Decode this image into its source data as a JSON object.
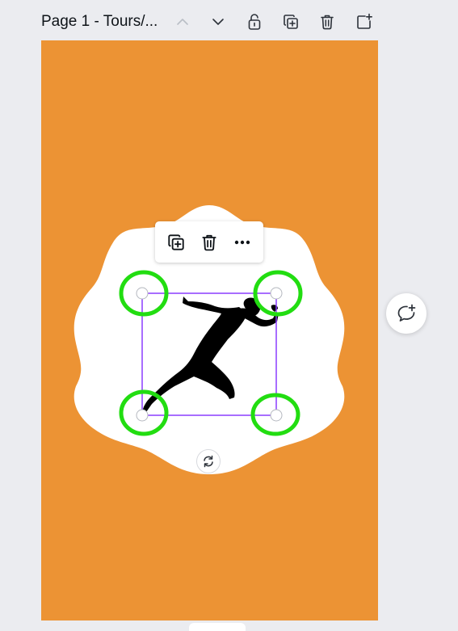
{
  "header": {
    "page_title": "Page 1 - Tours/...",
    "buttons": [
      {
        "name": "chevron-up-icon",
        "label": "Move page up"
      },
      {
        "name": "chevron-down-icon",
        "label": "Move page down"
      },
      {
        "name": "lock-icon",
        "label": "Lock page"
      },
      {
        "name": "duplicate-page-icon",
        "label": "Duplicate page"
      },
      {
        "name": "trash-icon",
        "label": "Delete page"
      },
      {
        "name": "add-page-icon",
        "label": "Add page"
      }
    ]
  },
  "canvas": {
    "background_color": "#ec9334",
    "badge_color": "#ffffff",
    "selection_color": "#8b3dff",
    "highlight_color": "#22dd11",
    "element": {
      "icon": "sprinter-silhouette-icon"
    }
  },
  "element_toolbar": {
    "buttons": [
      {
        "name": "duplicate-icon",
        "label": "Duplicate"
      },
      {
        "name": "trash-icon",
        "label": "Delete"
      },
      {
        "name": "more-icon",
        "label": "More"
      }
    ]
  },
  "rotate_handle": {
    "icon": "rotate-icon"
  },
  "side_actions": {
    "comment": {
      "icon": "add-comment-icon"
    }
  }
}
